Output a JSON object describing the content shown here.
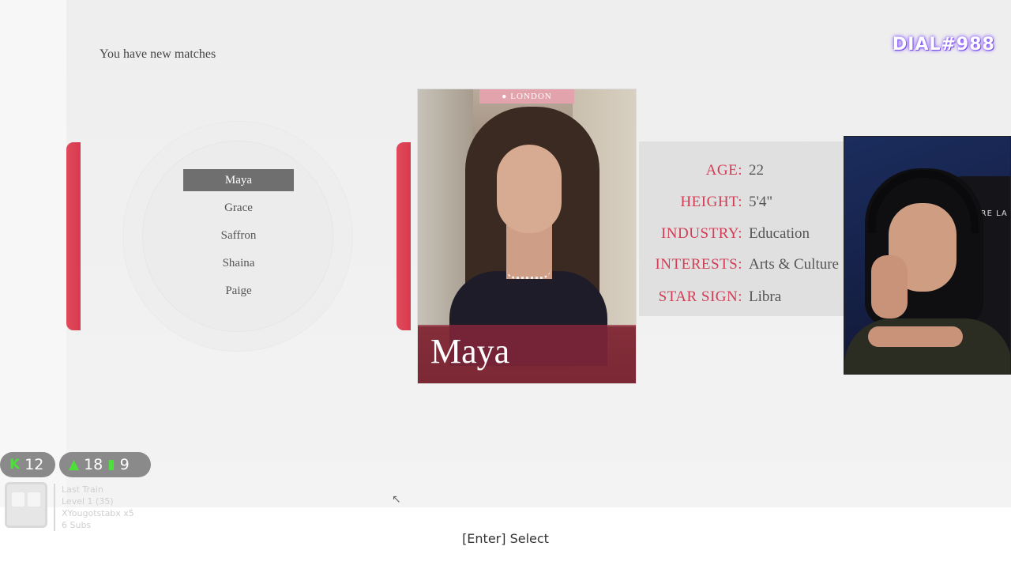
{
  "header": {
    "title": "You have new matches"
  },
  "matches": {
    "selected_index": 0,
    "names": [
      "Maya",
      "Grace",
      "Saffron",
      "Shaina",
      "Paige"
    ]
  },
  "profile": {
    "name": "Maya",
    "location": "LONDON",
    "age_label": "AGE:",
    "age": "22",
    "height_label": "HEIGHT:",
    "height": "5'4\"",
    "industry_label": "INDUSTRY:",
    "industry": "Education",
    "interests_label": "INTERESTS:",
    "interests": "Arts & Culture",
    "starsign_label": "STAR SIGN:",
    "starsign": "Libra"
  },
  "overlay": {
    "brand": "DIAL#988",
    "chair_text": "SECRE LA",
    "stat_a": "12",
    "stat_b1": "18",
    "stat_b2": "9",
    "train_line1": "Last Train",
    "train_line2": "Level 1 (35)",
    "train_line3": "XYougotstabx x5",
    "train_line4": "6 Subs"
  },
  "footer": {
    "hint": "[Enter] Select"
  },
  "colors": {
    "accent": "#d23d55",
    "selected_bg": "#6f6f6f",
    "namebar": "#962838"
  }
}
